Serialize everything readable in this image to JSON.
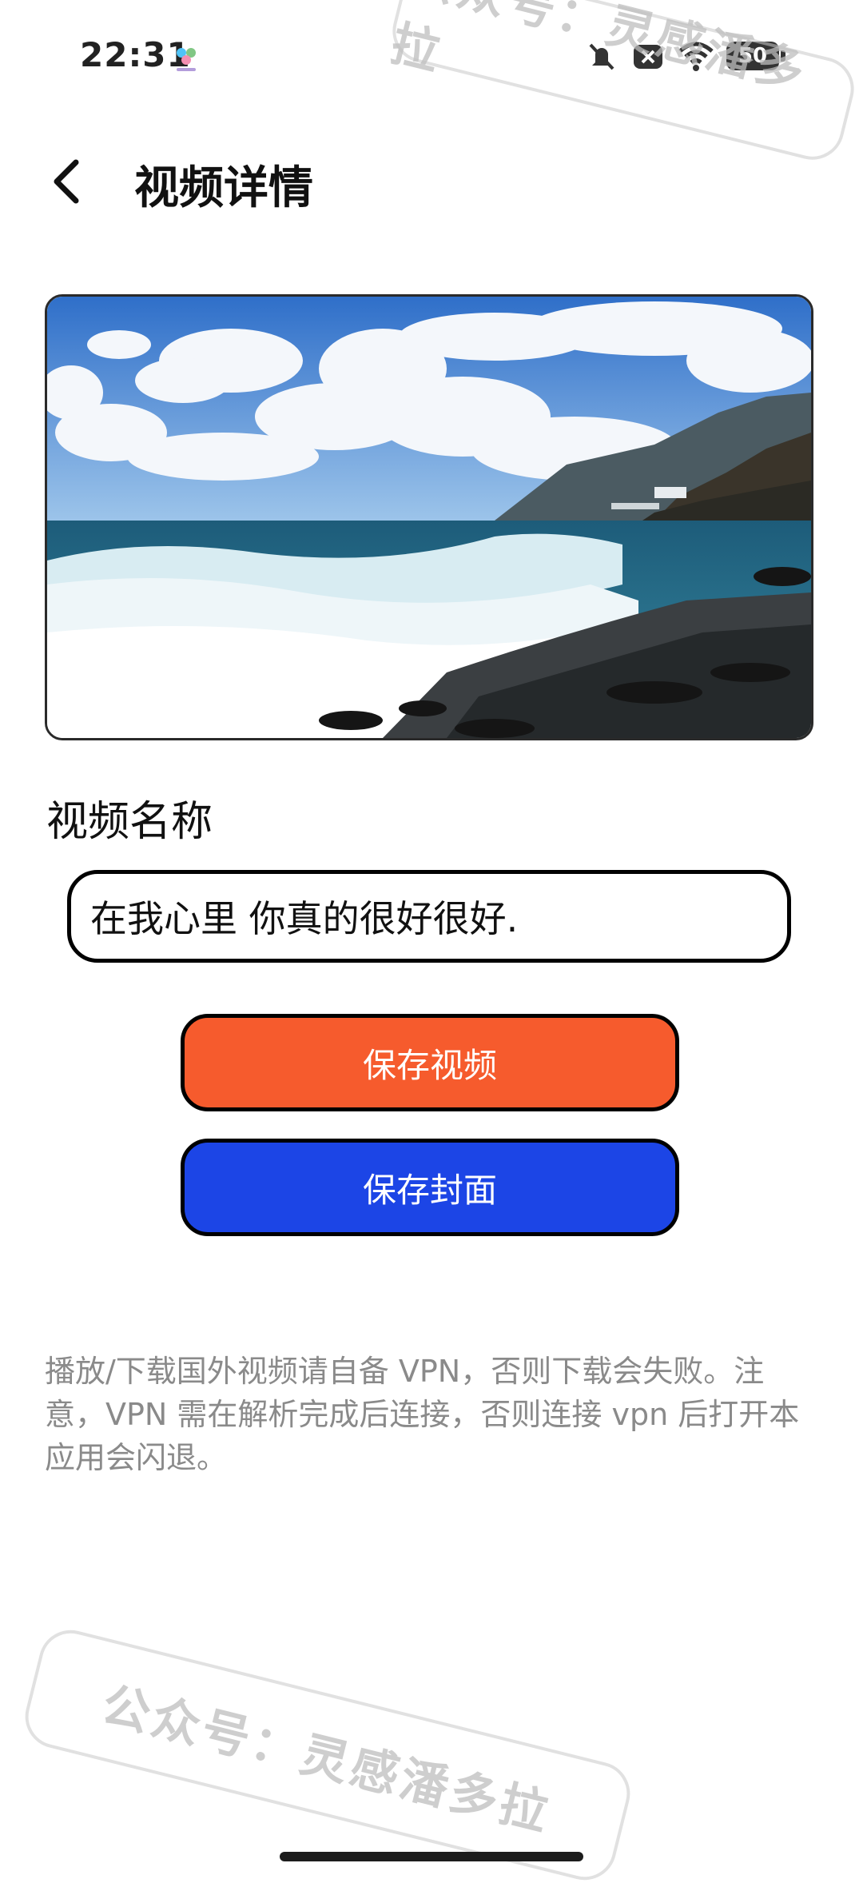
{
  "status_bar": {
    "time": "22:31",
    "battery": "50"
  },
  "header": {
    "title": "视频详情"
  },
  "video": {
    "name_label": "视频名称",
    "name_value": "在我心里 你真的很好很好."
  },
  "buttons": {
    "save_video": "保存视频",
    "save_cover": "保存封面"
  },
  "notice": "播放/下载国外视频请自备 VPN，否则下载会失败。注意，VPN 需在解析完成后连接，否则连接 vpn 后打开本应用会闪退。",
  "watermark": "公众号：灵感潘多拉",
  "colors": {
    "save_video_bg": "#f65b2d",
    "save_cover_bg": "#1c45e6"
  }
}
